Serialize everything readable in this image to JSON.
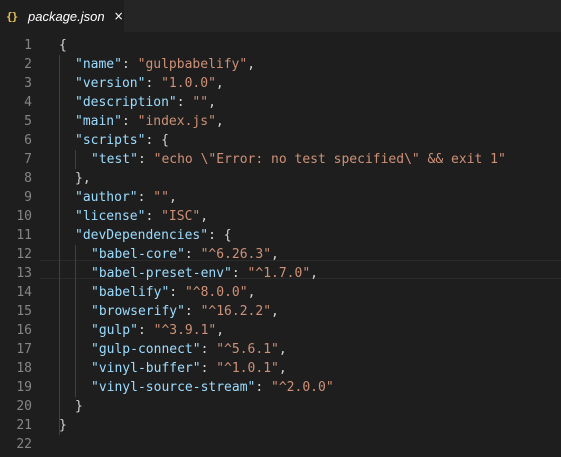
{
  "tab": {
    "icon": "{}",
    "label": "package.json",
    "close": "×"
  },
  "editor": {
    "lines": [
      {
        "n": "1",
        "code": "{"
      },
      {
        "n": "2",
        "key": "\"name\"",
        "mid": ": ",
        "val": "\"gulpbabelify\"",
        "end": ","
      },
      {
        "n": "3",
        "key": "\"version\"",
        "mid": ": ",
        "val": "\"1.0.0\"",
        "end": ","
      },
      {
        "n": "4",
        "key": "\"description\"",
        "mid": ": ",
        "val": "\"\"",
        "end": ","
      },
      {
        "n": "5",
        "key": "\"main\"",
        "mid": ": ",
        "val": "\"index.js\"",
        "end": ","
      },
      {
        "n": "6",
        "key": "\"scripts\"",
        "mid": ": {",
        "val": "",
        "end": ""
      },
      {
        "n": "7",
        "key": "\"test\"",
        "mid": ": ",
        "val": "\"echo \\\"Error: no test specified\\\" && exit 1\"",
        "end": ""
      },
      {
        "n": "8",
        "code": "},"
      },
      {
        "n": "9",
        "key": "\"author\"",
        "mid": ": ",
        "val": "\"\"",
        "end": ","
      },
      {
        "n": "10",
        "key": "\"license\"",
        "mid": ": ",
        "val": "\"ISC\"",
        "end": ","
      },
      {
        "n": "11",
        "key": "\"devDependencies\"",
        "mid": ": {",
        "val": "",
        "end": ""
      },
      {
        "n": "12",
        "key": "\"babel-core\"",
        "mid": ": ",
        "val": "\"^6.26.3\"",
        "end": ","
      },
      {
        "n": "13",
        "key": "\"babel-preset-env\"",
        "mid": ": ",
        "val": "\"^1.7.0\"",
        "end": ","
      },
      {
        "n": "14",
        "key": "\"babelify\"",
        "mid": ": ",
        "val": "\"^8.0.0\"",
        "end": ","
      },
      {
        "n": "15",
        "key": "\"browserify\"",
        "mid": ": ",
        "val": "\"^16.2.2\"",
        "end": ","
      },
      {
        "n": "16",
        "key": "\"gulp\"",
        "mid": ": ",
        "val": "\"^3.9.1\"",
        "end": ","
      },
      {
        "n": "17",
        "key": "\"gulp-connect\"",
        "mid": ": ",
        "val": "\"^5.6.1\"",
        "end": ","
      },
      {
        "n": "18",
        "key": "\"vinyl-buffer\"",
        "mid": ": ",
        "val": "\"^1.0.1\"",
        "end": ","
      },
      {
        "n": "19",
        "key": "\"vinyl-source-stream\"",
        "mid": ": ",
        "val": "\"^2.0.0\"",
        "end": ""
      },
      {
        "n": "20",
        "code": "}"
      },
      {
        "n": "21",
        "code": "}"
      },
      {
        "n": "22",
        "code": ""
      }
    ]
  }
}
